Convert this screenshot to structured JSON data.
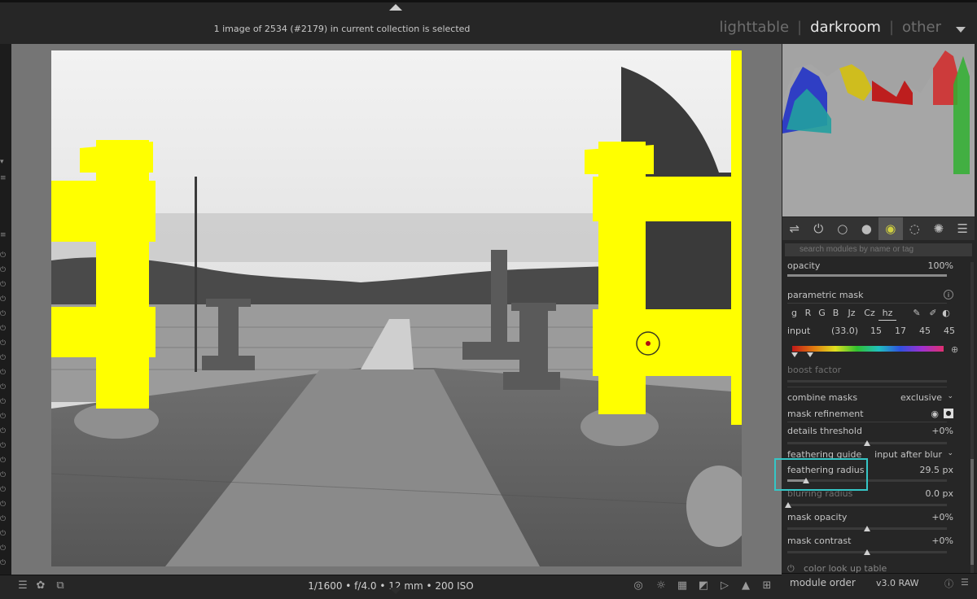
{
  "header": {
    "status": "1 image of 2534 (#2179) in current collection is selected",
    "views": [
      "lighttable",
      "darkroom",
      "other"
    ],
    "active_view": "darkroom",
    "separator": "|"
  },
  "bottom": {
    "exif": "1/1600 • f/4.0 • 12 mm • 200 ISO"
  },
  "right_panel": {
    "search_placeholder": "search modules by name or tag",
    "module_groups": [
      "quick-access-icon",
      "power-icon",
      "circle-icon",
      "tone-icon",
      "color-icon",
      "correct-icon",
      "effect-icon",
      "menu-icon"
    ],
    "opacity": {
      "label": "opacity",
      "value": "100%",
      "level": 1.0
    },
    "parametric_mask": {
      "label": "parametric mask",
      "info": "i"
    },
    "channels": [
      "g",
      "R",
      "G",
      "B",
      "Jz",
      "Cz",
      "hz"
    ],
    "selected_channel": "hz",
    "input": {
      "label": "input",
      "values": [
        "(33.0)",
        "15",
        "17",
        "45",
        "45"
      ]
    },
    "boost_factor": {
      "label": "boost factor"
    },
    "combine_masks": {
      "label": "combine masks",
      "value": "exclusive"
    },
    "mask_refinement": {
      "label": "mask refinement"
    },
    "details_threshold": {
      "label": "details threshold",
      "value": "+0%",
      "level": 0.5
    },
    "feathering_guide": {
      "label": "feathering guide",
      "value": "input after blur"
    },
    "feathering_radius": {
      "label": "feathering radius",
      "value": "29.5 px",
      "level": 0.118
    },
    "blurring_radius": {
      "label": "blurring radius",
      "value": "0.0 px",
      "level": 0.0
    },
    "mask_opacity": {
      "label": "mask opacity",
      "value": "+0%",
      "level": 0.5
    },
    "mask_contrast": {
      "label": "mask contrast",
      "value": "+0%",
      "level": 0.5
    },
    "next_module": {
      "label": "color look up table"
    },
    "footer": {
      "module_order_label": "module order",
      "module_order_value": "v3.0 RAW"
    }
  },
  "colors": {
    "mask_overlay": "#ffff00",
    "highlight_box": "#35c6c6",
    "panel_bg": "#262626",
    "image_bg": "#757575"
  }
}
